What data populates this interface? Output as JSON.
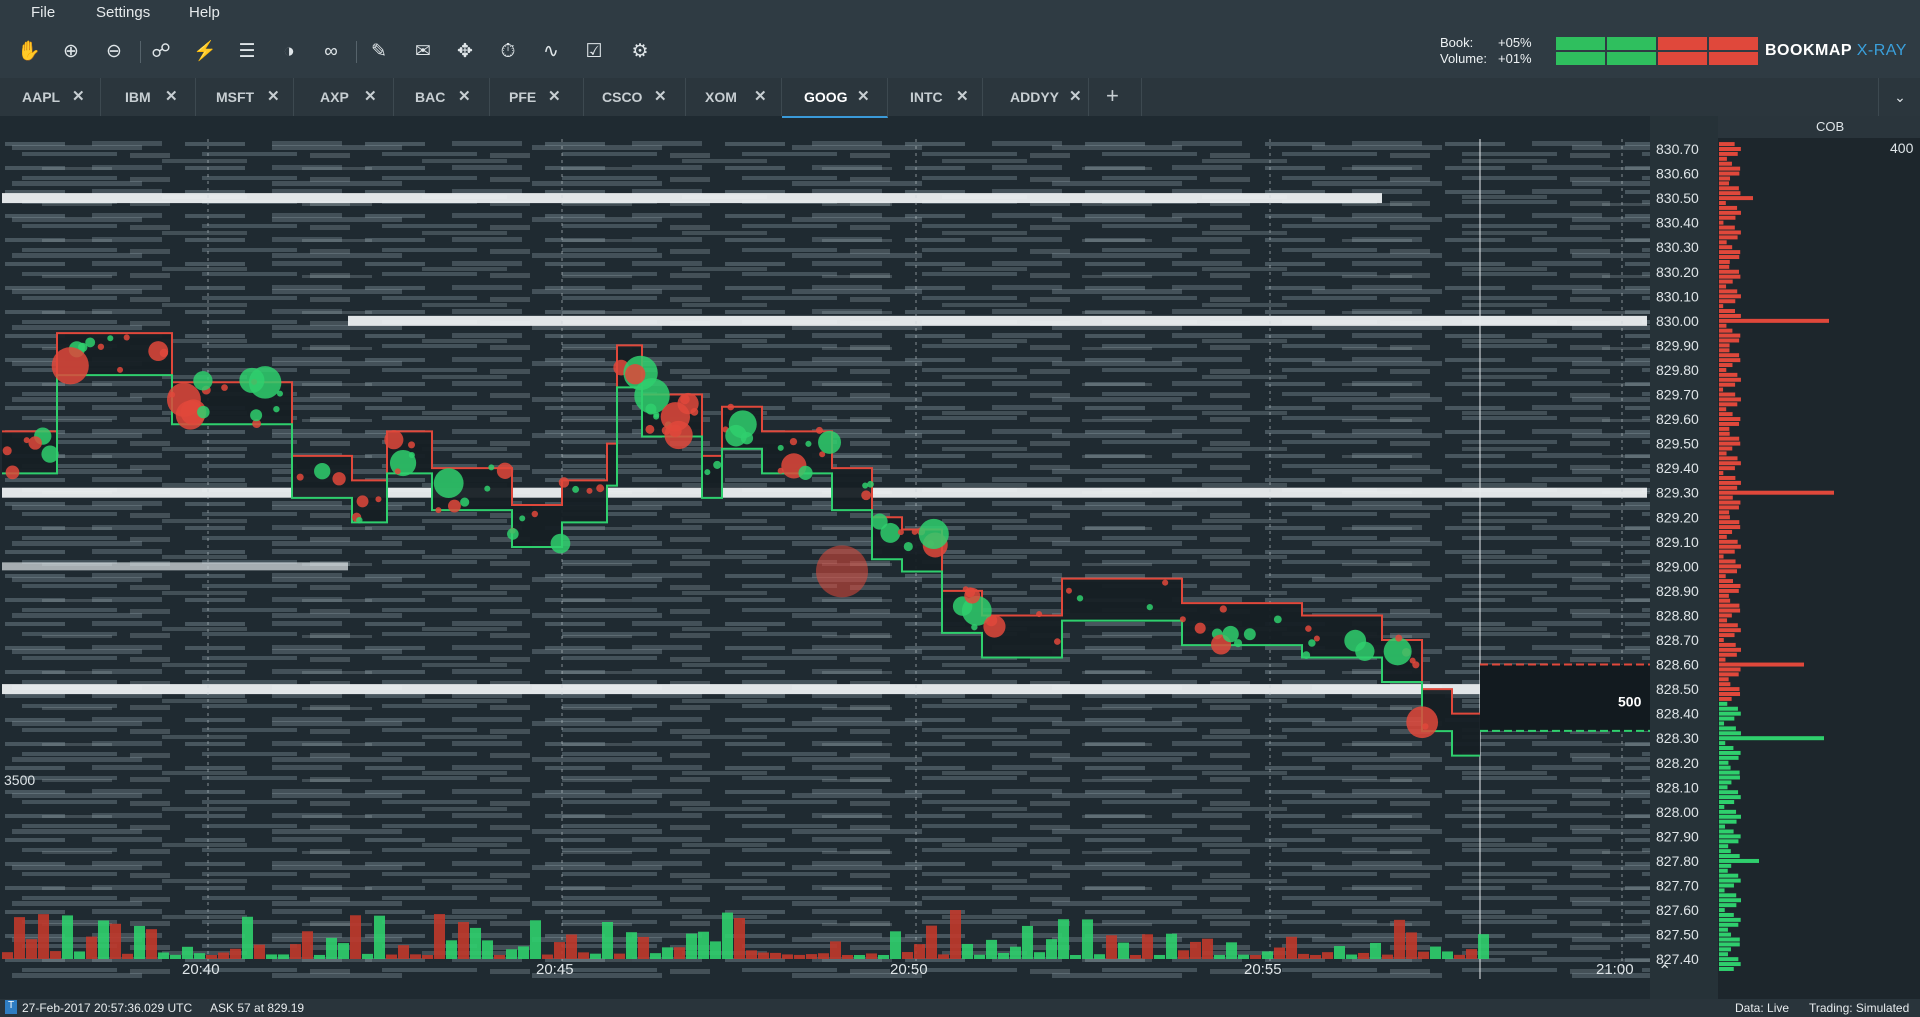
{
  "menu": {
    "file": "File",
    "settings": "Settings",
    "help": "Help"
  },
  "toolbar": {
    "tools": [
      "hand-icon",
      "zoom-in-icon",
      "zoom-out-icon",
      "share-icon",
      "heatmap-settings-icon",
      "layers-icon",
      "brightness-icon",
      "link-icon",
      "pencil-icon",
      "chat-icon",
      "crosshair-icon",
      "timer-icon",
      "indicators-icon",
      "lock-icon",
      "gear-icon"
    ],
    "book_label": "Book:",
    "book_value": "+05%",
    "volume_label": "Volume:",
    "volume_value": "+01%",
    "meter_colors": [
      "#2fbf5e",
      "#e0483b"
    ]
  },
  "brand": {
    "name": "BOOKMAP",
    "suffix": "X-RAY"
  },
  "tabs": [
    {
      "label": "AAPL"
    },
    {
      "label": "IBM"
    },
    {
      "label": "MSFT"
    },
    {
      "label": "AXP"
    },
    {
      "label": "BAC"
    },
    {
      "label": "PFE"
    },
    {
      "label": "CSCO"
    },
    {
      "label": "XOM"
    },
    {
      "label": "GOOG",
      "active": true
    },
    {
      "label": "INTC"
    },
    {
      "label": "ADDYY"
    }
  ],
  "add_tab": "+",
  "chart": {
    "time_labels": [
      "20:40",
      "20:45",
      "20:50",
      "20:55",
      "21:00"
    ],
    "price_labels": [
      "830.70",
      "830.60",
      "830.50",
      "830.40",
      "830.30",
      "830.20",
      "830.10",
      "830.00",
      "829.90",
      "829.80",
      "829.70",
      "829.60",
      "829.50",
      "829.40",
      "829.30",
      "829.20",
      "829.10",
      "829.00",
      "828.90",
      "828.80",
      "828.70",
      "828.60",
      "828.50",
      "828.40",
      "828.30",
      "828.20",
      "828.10",
      "828.00",
      "827.90",
      "827.80",
      "827.70",
      "827.60",
      "827.50",
      "827.40"
    ],
    "volume_scale": "3500",
    "spread_size": "500",
    "cob_title": "COB",
    "cob_scale": "400",
    "colors": {
      "bid": "#2fcf6d",
      "ask": "#e0483b"
    }
  },
  "status": {
    "timestamp": "27-Feb-2017 20:57:36.029 UTC",
    "last_trade": "ASK 57 at 829.19",
    "data": "Data: Live",
    "trading": "Trading: Simulated"
  }
}
